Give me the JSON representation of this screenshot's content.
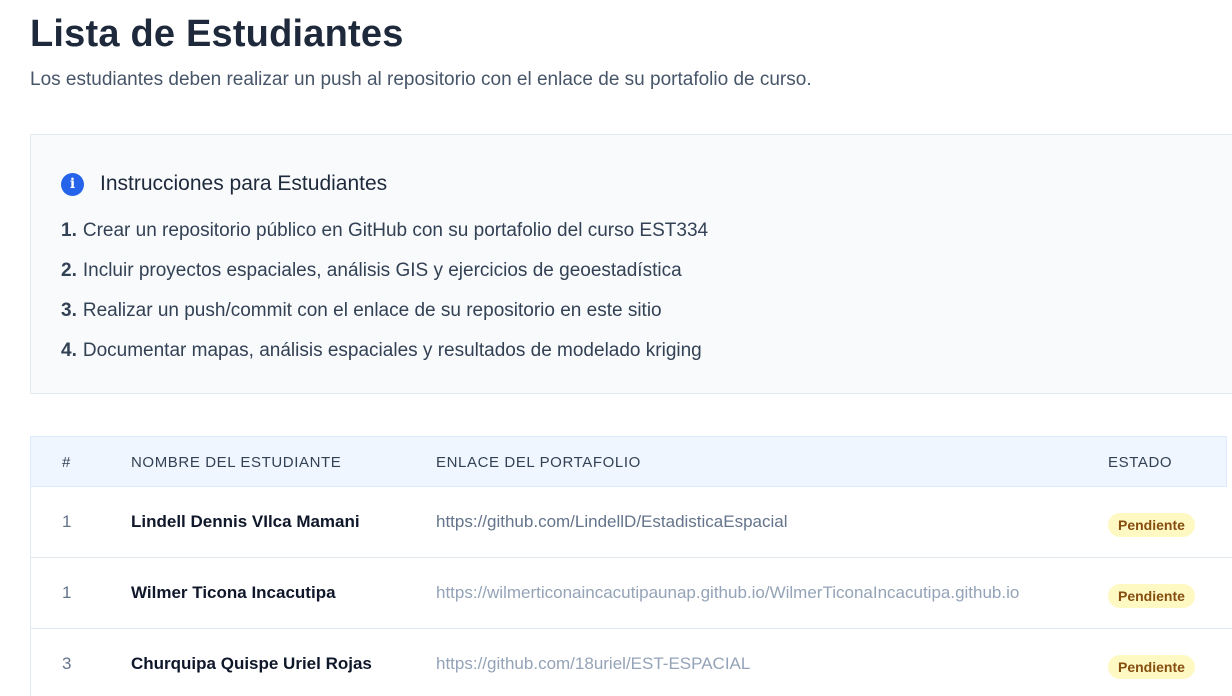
{
  "header": {
    "title": "Lista de Estudiantes",
    "subtitle": "Los estudiantes deben realizar un push al repositorio con el enlace de su portafolio de curso."
  },
  "instructions": {
    "icon": "info-icon",
    "title": "Instrucciones para Estudiantes",
    "items": [
      {
        "num": "1.",
        "text": "Crear un repositorio público en GitHub con su portafolio del curso EST334"
      },
      {
        "num": "2.",
        "text": "Incluir proyectos espaciales, análisis GIS y ejercicios de geoestadística"
      },
      {
        "num": "3.",
        "text": "Realizar un push/commit con el enlace de su repositorio en este sitio"
      },
      {
        "num": "4.",
        "text": "Documentar mapas, análisis espaciales y resultados de modelado kriging"
      }
    ]
  },
  "table": {
    "columns": [
      "#",
      "NOMBRE DEL ESTUDIANTE",
      "ENLACE DEL PORTAFOLIO",
      "ESTADO"
    ],
    "rows": [
      {
        "num": "1",
        "name": "Lindell Dennis VIlca Mamani",
        "link": "https://github.com/LindellD/EstadisticaEspacial",
        "status": "Pendiente"
      },
      {
        "num": "1",
        "name": "Wilmer Ticona Incacutipa",
        "link": "https://wilmerticonaincacutipaunap.github.io/WilmerTiconaIncacutipa.github.io",
        "status": "Pendiente"
      },
      {
        "num": "3",
        "name": "Churquipa Quispe Uriel Rojas",
        "link": "https://github.com/18uriel/EST-ESPACIAL",
        "status": "Pendiente"
      }
    ]
  },
  "colors": {
    "accent": "#2563eb",
    "header_bg": "#eff6ff",
    "badge_bg": "#fef9c3",
    "badge_text": "#854d0e"
  }
}
